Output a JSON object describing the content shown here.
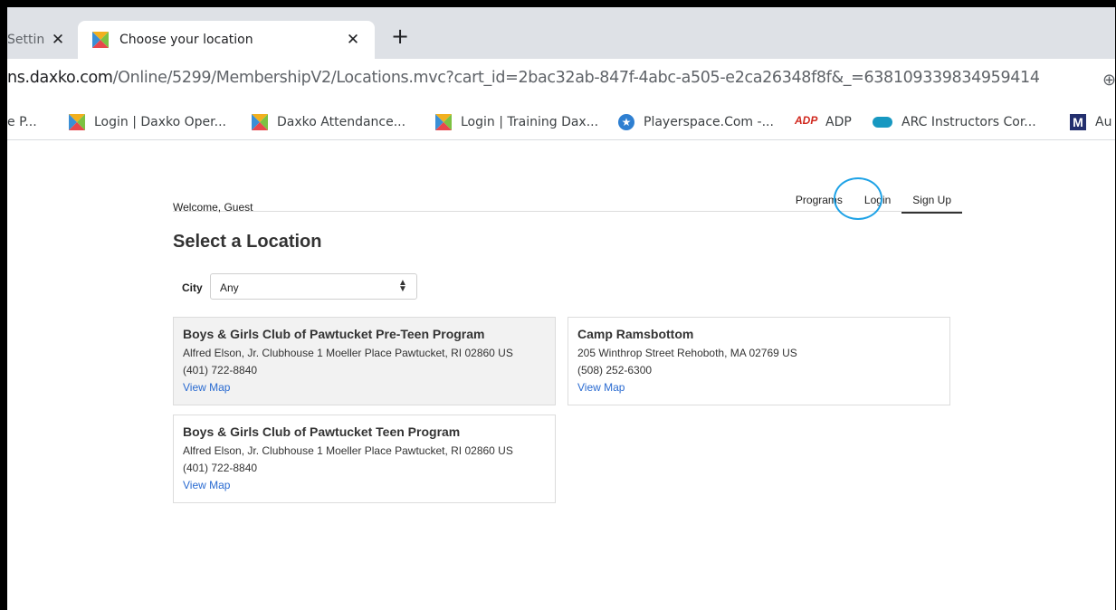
{
  "browser": {
    "tabs": [
      {
        "title": "Settin",
        "active": false
      },
      {
        "title": "Choose your location",
        "active": true
      }
    ],
    "new_tab_label": "+",
    "close_glyph": "✕",
    "url": {
      "host": "ns.daxko.com",
      "path": "/Online/5299/MembershipV2/Locations.mvc?cart_id=2bac32ab-847f-4abc-a505-e2ca26348f8f&_=638109339834959414"
    },
    "bookmarks": [
      {
        "label": "e P...",
        "icon": "none"
      },
      {
        "label": "Login | Daxko Oper...",
        "icon": "daxko-icon"
      },
      {
        "label": "Daxko Attendance...",
        "icon": "daxko-icon"
      },
      {
        "label": "Login | Training Dax...",
        "icon": "daxko-icon"
      },
      {
        "label": "Playerspace.Com -...",
        "icon": "star-badge-icon"
      },
      {
        "label": "ADP",
        "icon": "adp-logo-icon"
      },
      {
        "label": "ARC Instructors Cor...",
        "icon": "salesforce-cloud-icon"
      },
      {
        "label": "Au",
        "icon": "m-logo-icon"
      }
    ],
    "adp_logo_text": "ADP",
    "m_logo_text": "M"
  },
  "page": {
    "welcome": "Welcome, Guest",
    "nav": {
      "programs": "Programs",
      "login": "Login",
      "signup": "Sign Up"
    },
    "title": "Select a Location",
    "filter": {
      "label": "City",
      "selected": "Any"
    },
    "locations": [
      {
        "name": "Boys & Girls Club of Pawtucket Pre-Teen Program",
        "address": "Alfred Elson, Jr. Clubhouse 1 Moeller Place Pawtucket, RI 02860 US",
        "phone": "(401) 722-8840",
        "map_link": "View Map",
        "highlighted": true
      },
      {
        "name": "Camp Ramsbottom",
        "address": "205 Winthrop Street Rehoboth, MA 02769 US",
        "phone": "(508) 252-6300",
        "map_link": "View Map",
        "highlighted": false
      },
      {
        "name": "Boys & Girls Club of Pawtucket Teen Program",
        "address": "Alfred Elson, Jr. Clubhouse 1 Moeller Place Pawtucket, RI 02860 US",
        "phone": "(401) 722-8840",
        "map_link": "View Map",
        "highlighted": false
      }
    ]
  },
  "colors": {
    "link": "#2a6bd1",
    "annotation_circle": "#1ea2e6",
    "card_highlight": "#f2f2f2"
  }
}
